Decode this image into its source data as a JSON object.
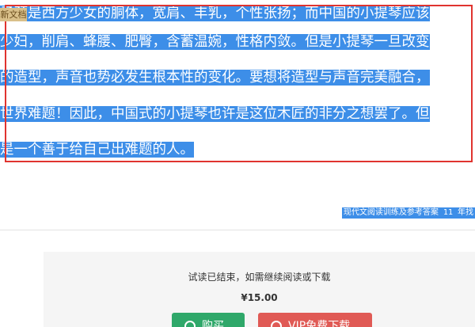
{
  "document": {
    "tag": "新文档",
    "lines": [
      "子颈是西方少女的胴体，宽肩、丰乳，个性张扬；而中国的小提琴应该",
      "少妇，削肩、蜂腰、肥臀，含蓄温婉，性格内敛。但是小提琴一旦改变",
      "的造型，声音也势必发生根本性的变化。要想将造型与声音完美融合，",
      "世界难题！因此，中国式的小提琴也许是这位木匠的非分之想罢了。但",
      "是一个善于给自己出难题的人。"
    ],
    "footer_note": "现代文阅读训练及参考答案 11 年找"
  },
  "paywall": {
    "message": "试读已结束，如需继续阅读或下载",
    "price": "¥15.00",
    "buy_label": "购买",
    "vip_label": "VIP免费下载"
  },
  "colors": {
    "highlight": "#3d8ee8",
    "frame": "#e0342f",
    "buy": "#2fa86a",
    "vip": "#e05a55",
    "tag": "#d9c08a"
  }
}
